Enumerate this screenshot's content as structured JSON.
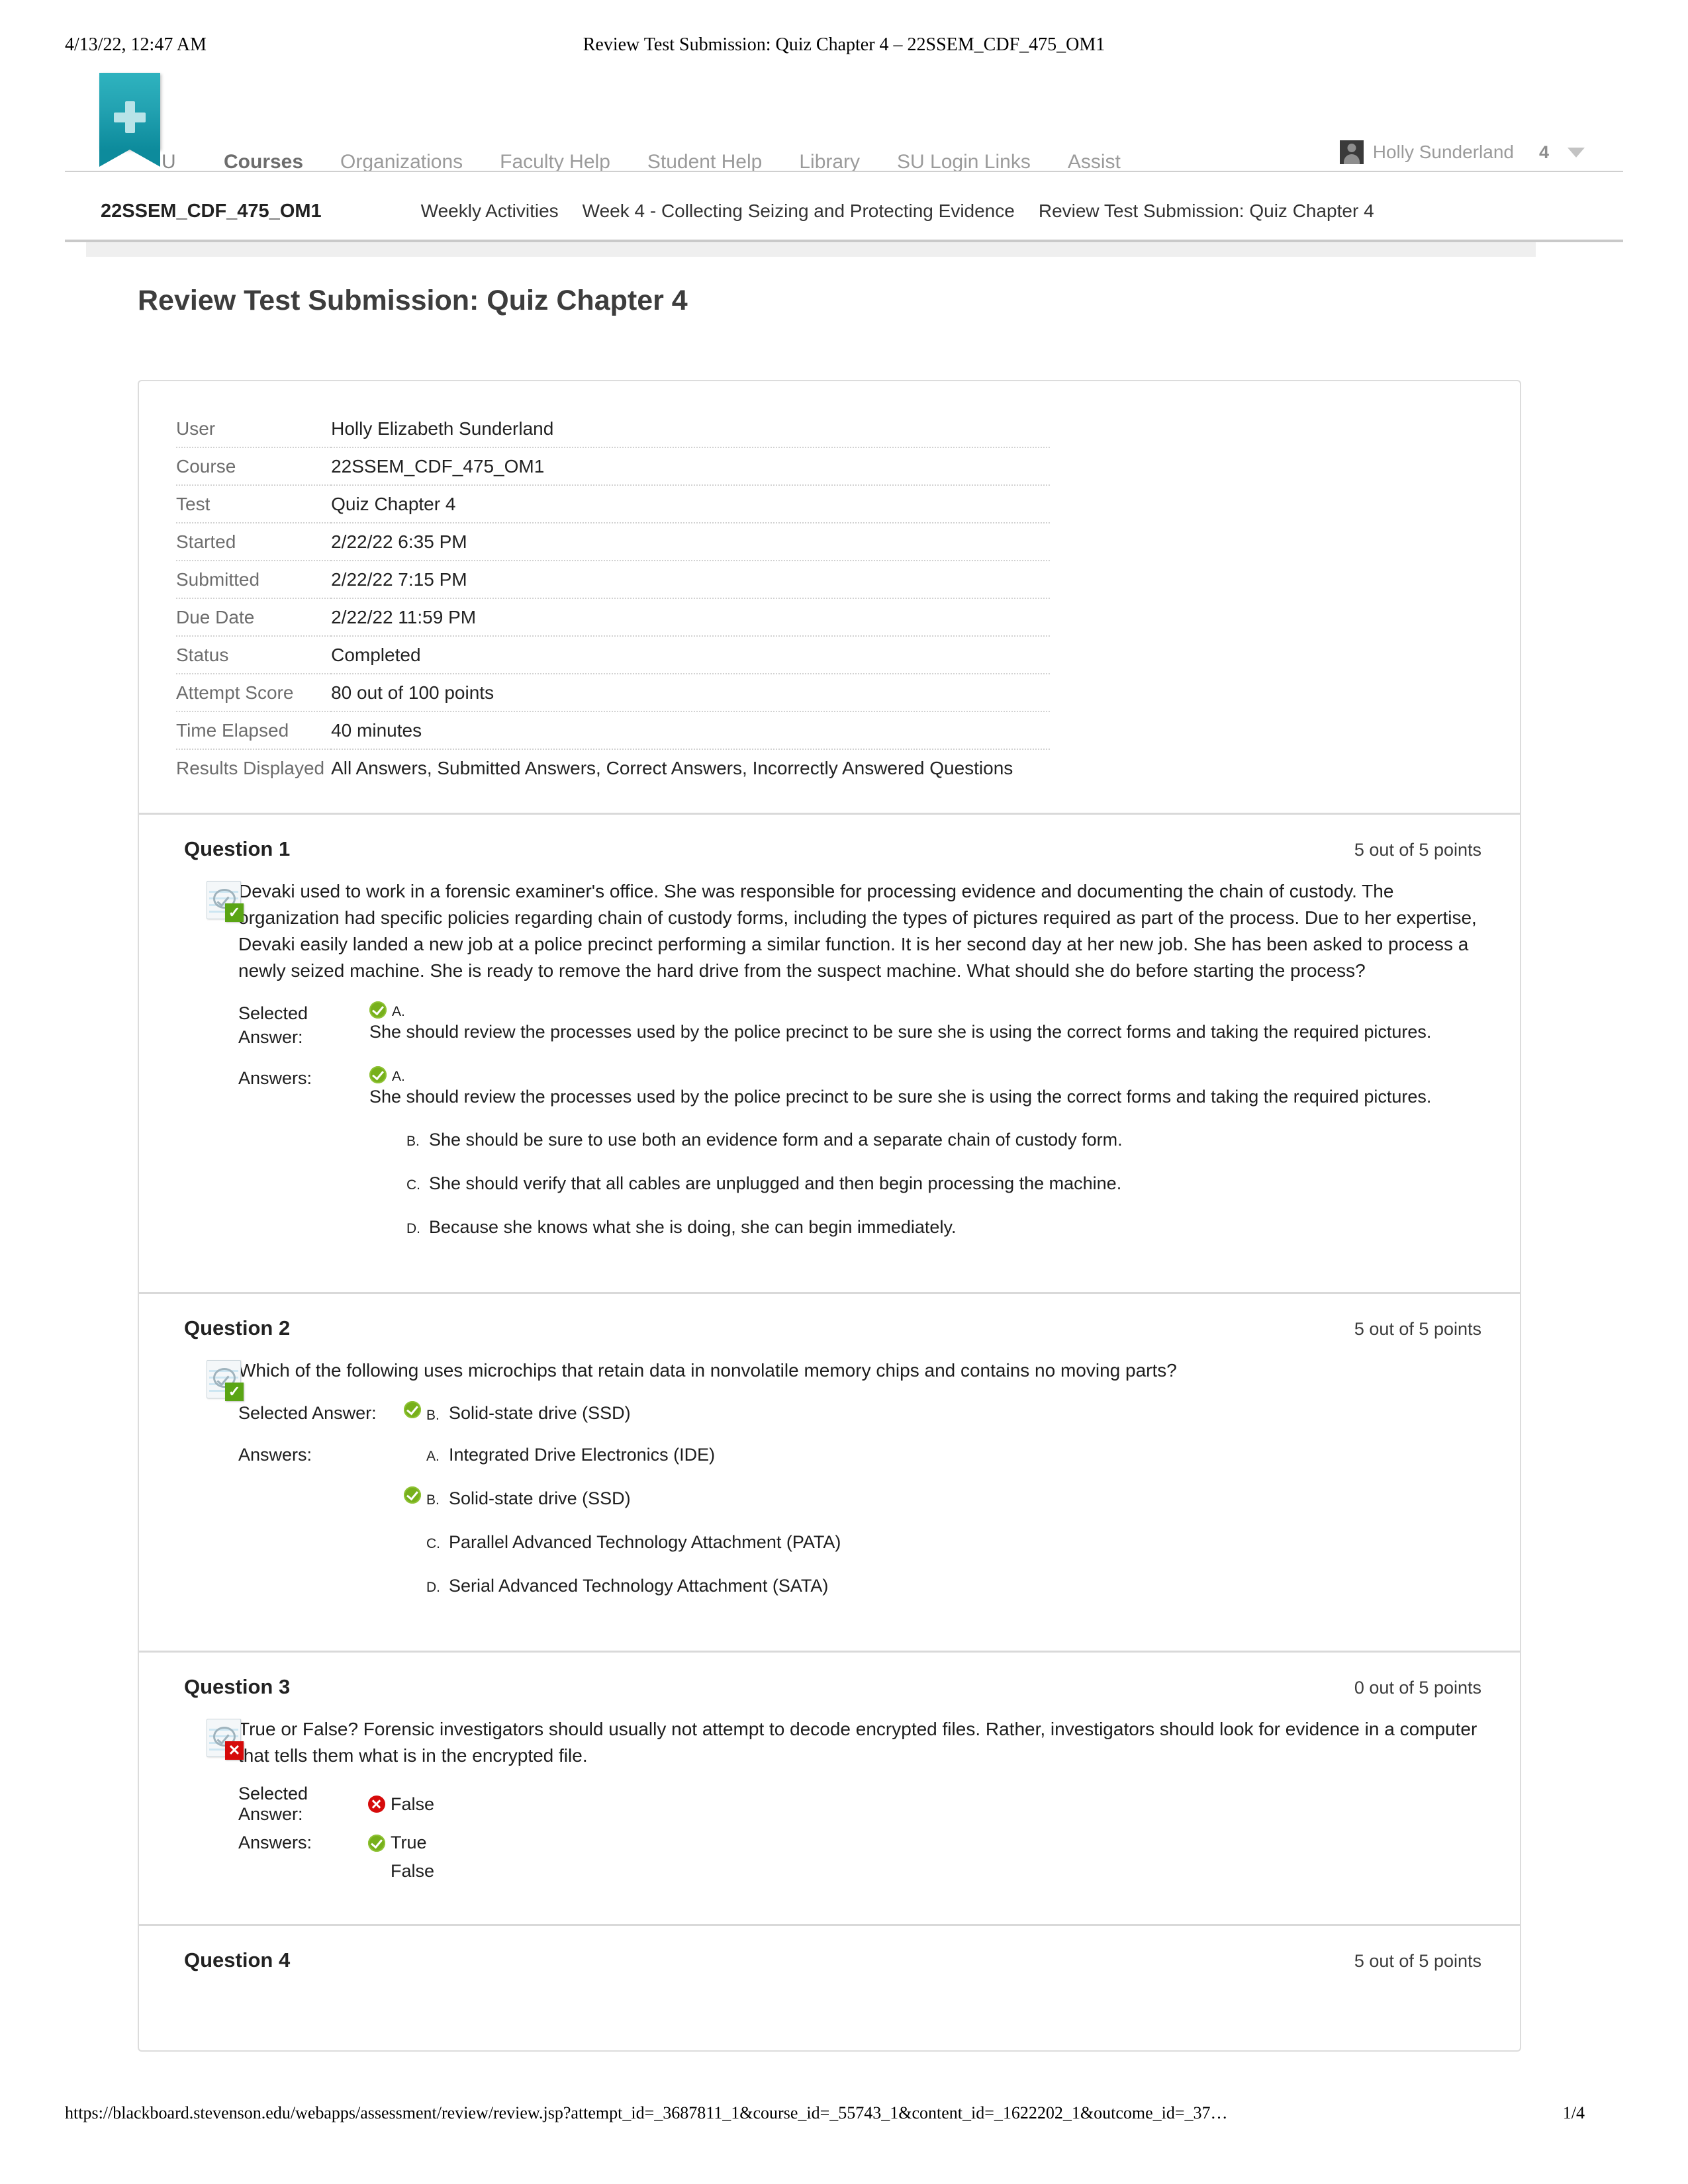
{
  "print": {
    "date": "4/13/22, 12:47 AM",
    "title": "Review Test Submission: Quiz Chapter 4 – 22SSEM_CDF_475_OM1"
  },
  "topnav": {
    "brand_letter": "U",
    "links": [
      {
        "label": "Courses",
        "active": true
      },
      {
        "label": "Organizations",
        "active": false
      },
      {
        "label": "Faculty Help",
        "active": false
      },
      {
        "label": "Student Help",
        "active": false
      },
      {
        "label": "Library",
        "active": false
      },
      {
        "label": "SU Login Links",
        "active": false
      },
      {
        "label": "Assist",
        "active": false
      }
    ],
    "user_name": "Holly Sunderland",
    "user_count": "4"
  },
  "breadcrumb": {
    "course_id": "22SSEM_CDF_475_OM1",
    "crumbs": [
      "Weekly Activities",
      "Week 4 - Collecting Seizing and Protecting Evidence",
      "Review Test Submission: Quiz Chapter 4"
    ]
  },
  "page_title": "Review Test Submission: Quiz Chapter 4",
  "info_table": [
    {
      "key": "User",
      "value": "Holly Elizabeth Sunderland"
    },
    {
      "key": "Course",
      "value": "22SSEM_CDF_475_OM1"
    },
    {
      "key": "Test",
      "value": "Quiz Chapter 4"
    },
    {
      "key": "Started",
      "value": "2/22/22 6:35 PM"
    },
    {
      "key": "Submitted",
      "value": "2/22/22 7:15 PM"
    },
    {
      "key": "Due Date",
      "value": "2/22/22 11:59 PM"
    },
    {
      "key": "Status",
      "value": "Completed"
    },
    {
      "key": "Attempt Score",
      "value": "80 out of 100 points"
    },
    {
      "key": "Time Elapsed",
      "value": "40 minutes"
    },
    {
      "key": "Results Displayed",
      "value": "All Answers, Submitted Answers, Correct Answers, Incorrectly Answered Questions"
    }
  ],
  "questions": [
    {
      "title": "Question 1",
      "points": "5 out of 5 points",
      "status": "correct",
      "text": "Devaki used to work in a forensic examiner's office. She was responsible for processing evidence and documenting the chain of custody. The organization had specific policies regarding chain of custody forms, including the types of pictures required as part of the process. Due to her expertise, Devaki easily landed a new job at a police precinct performing a similar function. It is her second day at her new job. She has been asked to process a newly seized machine. She is ready to remove the hard drive from the suspect machine. What should she do before starting the process?",
      "selected_label": "Selected Answer:",
      "selected_letter": "A.",
      "selected_mark": "correct",
      "selected_text": "She should review the processes used by the police precinct to be sure she is using the correct forms and taking the required pictures.",
      "answers_label": "Answers:",
      "first_answer_letter": "A.",
      "first_answer_mark": "correct",
      "first_answer_text": "She should review the processes used by the police precinct to be sure she is using the correct forms and taking the required pictures.",
      "options": [
        {
          "letter": "B.",
          "mark": "none",
          "text": "She should be sure to use both an evidence form and a separate chain of custody form."
        },
        {
          "letter": "C.",
          "mark": "none",
          "text": "She should verify that all cables are unplugged and then begin processing the machine."
        },
        {
          "letter": "D.",
          "mark": "none",
          "text": "Because she knows what she is doing, she can begin immediately."
        }
      ]
    },
    {
      "title": "Question 2",
      "points": "5 out of 5 points",
      "status": "correct",
      "text": "Which of the following uses microchips that retain data in nonvolatile memory chips and contains no moving parts?",
      "selected_label": "Selected Answer:",
      "selected_letter": "B.",
      "selected_mark": "correct",
      "selected_text": "Solid-state drive (SSD)",
      "answers_label": "Answers:",
      "options": [
        {
          "letter": "A.",
          "mark": "none",
          "text": "Integrated Drive Electronics (IDE)"
        },
        {
          "letter": "B.",
          "mark": "correct",
          "text": "Solid-state drive (SSD)"
        },
        {
          "letter": "C.",
          "mark": "none",
          "text": "Parallel Advanced Technology Attachment (PATA)"
        },
        {
          "letter": "D.",
          "mark": "none",
          "text": "Serial Advanced Technology Attachment (SATA)"
        }
      ]
    },
    {
      "title": "Question 3",
      "points": "0 out of 5 points",
      "status": "wrong",
      "text": "True or False? Forensic investigators should usually not attempt to decode encrypted files. Rather, investigators should look for evidence in a computer that tells them what is in the encrypted file.",
      "selected_label": "Selected Answer:",
      "selected_mark": "wrong",
      "selected_text": "False",
      "answers_label": "Answers:",
      "tf_options": [
        {
          "mark": "correct",
          "text": "True"
        },
        {
          "mark": "none",
          "text": "False"
        }
      ]
    },
    {
      "title": "Question 4",
      "points": "5 out of 5 points"
    }
  ],
  "footer": {
    "url": "https://blackboard.stevenson.edu/webapps/assessment/review/review.jsp?attempt_id=_3687811_1&course_id=_55743_1&content_id=_1622202_1&outcome_id=_37…",
    "page": "1/4"
  }
}
